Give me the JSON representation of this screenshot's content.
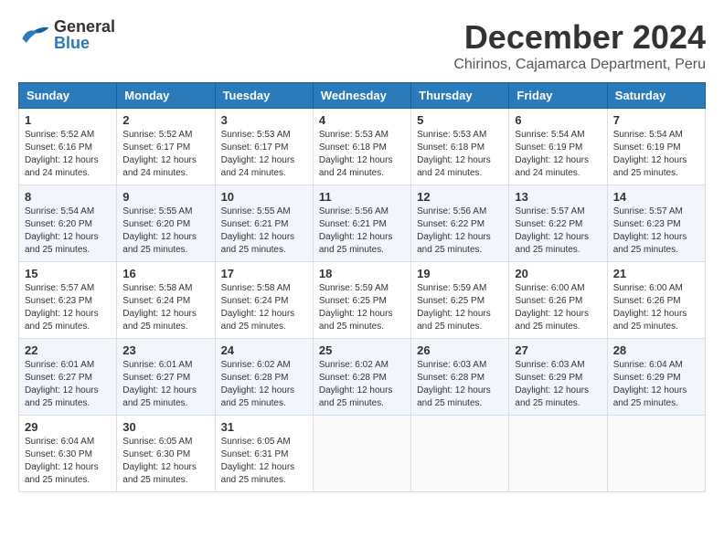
{
  "header": {
    "logo_general": "General",
    "logo_blue": "Blue",
    "title": "December 2024",
    "subtitle": "Chirinos, Cajamarca Department, Peru"
  },
  "calendar": {
    "days_of_week": [
      "Sunday",
      "Monday",
      "Tuesday",
      "Wednesday",
      "Thursday",
      "Friday",
      "Saturday"
    ],
    "weeks": [
      [
        {
          "day": "1",
          "sunrise": "5:52 AM",
          "sunset": "6:16 PM",
          "daylight": "12 hours and 24 minutes."
        },
        {
          "day": "2",
          "sunrise": "5:52 AM",
          "sunset": "6:17 PM",
          "daylight": "12 hours and 24 minutes."
        },
        {
          "day": "3",
          "sunrise": "5:53 AM",
          "sunset": "6:17 PM",
          "daylight": "12 hours and 24 minutes."
        },
        {
          "day": "4",
          "sunrise": "5:53 AM",
          "sunset": "6:18 PM",
          "daylight": "12 hours and 24 minutes."
        },
        {
          "day": "5",
          "sunrise": "5:53 AM",
          "sunset": "6:18 PM",
          "daylight": "12 hours and 24 minutes."
        },
        {
          "day": "6",
          "sunrise": "5:54 AM",
          "sunset": "6:19 PM",
          "daylight": "12 hours and 24 minutes."
        },
        {
          "day": "7",
          "sunrise": "5:54 AM",
          "sunset": "6:19 PM",
          "daylight": "12 hours and 25 minutes."
        }
      ],
      [
        {
          "day": "8",
          "sunrise": "5:54 AM",
          "sunset": "6:20 PM",
          "daylight": "12 hours and 25 minutes."
        },
        {
          "day": "9",
          "sunrise": "5:55 AM",
          "sunset": "6:20 PM",
          "daylight": "12 hours and 25 minutes."
        },
        {
          "day": "10",
          "sunrise": "5:55 AM",
          "sunset": "6:21 PM",
          "daylight": "12 hours and 25 minutes."
        },
        {
          "day": "11",
          "sunrise": "5:56 AM",
          "sunset": "6:21 PM",
          "daylight": "12 hours and 25 minutes."
        },
        {
          "day": "12",
          "sunrise": "5:56 AM",
          "sunset": "6:22 PM",
          "daylight": "12 hours and 25 minutes."
        },
        {
          "day": "13",
          "sunrise": "5:57 AM",
          "sunset": "6:22 PM",
          "daylight": "12 hours and 25 minutes."
        },
        {
          "day": "14",
          "sunrise": "5:57 AM",
          "sunset": "6:23 PM",
          "daylight": "12 hours and 25 minutes."
        }
      ],
      [
        {
          "day": "15",
          "sunrise": "5:57 AM",
          "sunset": "6:23 PM",
          "daylight": "12 hours and 25 minutes."
        },
        {
          "day": "16",
          "sunrise": "5:58 AM",
          "sunset": "6:24 PM",
          "daylight": "12 hours and 25 minutes."
        },
        {
          "day": "17",
          "sunrise": "5:58 AM",
          "sunset": "6:24 PM",
          "daylight": "12 hours and 25 minutes."
        },
        {
          "day": "18",
          "sunrise": "5:59 AM",
          "sunset": "6:25 PM",
          "daylight": "12 hours and 25 minutes."
        },
        {
          "day": "19",
          "sunrise": "5:59 AM",
          "sunset": "6:25 PM",
          "daylight": "12 hours and 25 minutes."
        },
        {
          "day": "20",
          "sunrise": "6:00 AM",
          "sunset": "6:26 PM",
          "daylight": "12 hours and 25 minutes."
        },
        {
          "day": "21",
          "sunrise": "6:00 AM",
          "sunset": "6:26 PM",
          "daylight": "12 hours and 25 minutes."
        }
      ],
      [
        {
          "day": "22",
          "sunrise": "6:01 AM",
          "sunset": "6:27 PM",
          "daylight": "12 hours and 25 minutes."
        },
        {
          "day": "23",
          "sunrise": "6:01 AM",
          "sunset": "6:27 PM",
          "daylight": "12 hours and 25 minutes."
        },
        {
          "day": "24",
          "sunrise": "6:02 AM",
          "sunset": "6:28 PM",
          "daylight": "12 hours and 25 minutes."
        },
        {
          "day": "25",
          "sunrise": "6:02 AM",
          "sunset": "6:28 PM",
          "daylight": "12 hours and 25 minutes."
        },
        {
          "day": "26",
          "sunrise": "6:03 AM",
          "sunset": "6:28 PM",
          "daylight": "12 hours and 25 minutes."
        },
        {
          "day": "27",
          "sunrise": "6:03 AM",
          "sunset": "6:29 PM",
          "daylight": "12 hours and 25 minutes."
        },
        {
          "day": "28",
          "sunrise": "6:04 AM",
          "sunset": "6:29 PM",
          "daylight": "12 hours and 25 minutes."
        }
      ],
      [
        {
          "day": "29",
          "sunrise": "6:04 AM",
          "sunset": "6:30 PM",
          "daylight": "12 hours and 25 minutes."
        },
        {
          "day": "30",
          "sunrise": "6:05 AM",
          "sunset": "6:30 PM",
          "daylight": "12 hours and 25 minutes."
        },
        {
          "day": "31",
          "sunrise": "6:05 AM",
          "sunset": "6:31 PM",
          "daylight": "12 hours and 25 minutes."
        },
        null,
        null,
        null,
        null
      ]
    ]
  }
}
